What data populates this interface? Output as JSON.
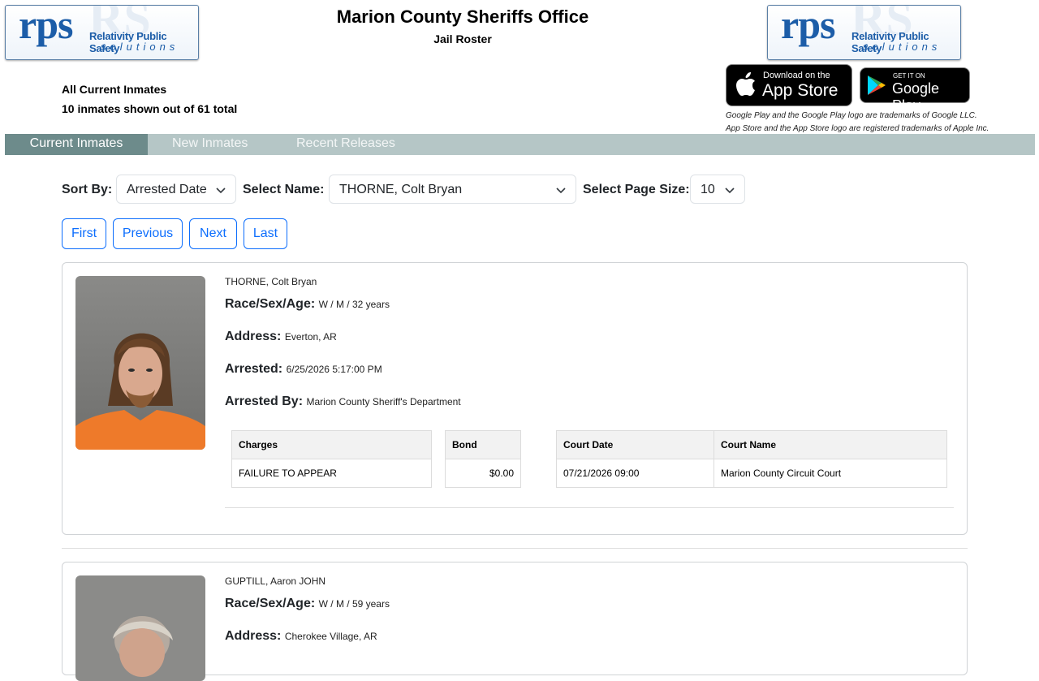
{
  "header": {
    "title": "Marion County Sheriffs Office",
    "subtitle": "Jail Roster"
  },
  "logo": {
    "letters": "rps",
    "line1": "Relativity Public Safety",
    "line2": "solutions"
  },
  "summary": {
    "line1": "All Current Inmates",
    "line2": "10 inmates shown out of 61 total"
  },
  "stores": {
    "apple_small": "Download on the",
    "apple_big": "App Store",
    "google_small": "GET IT ON",
    "google_big": "Google Play",
    "trademark1": "Google Play and the Google Play logo are trademarks of Google LLC.",
    "trademark2": "App Store and the App Store logo are registered trademarks of Apple Inc."
  },
  "tabs": [
    "Current Inmates",
    "New Inmates",
    "Recent Releases"
  ],
  "controls": {
    "sort_label": "Sort By:",
    "sort_value": "Arrested Date",
    "name_label": "Select Name:",
    "name_value": "THORNE, Colt Bryan",
    "size_label": "Select Page Size:",
    "size_value": "10"
  },
  "pager": {
    "first": "First",
    "previous": "Previous",
    "next": "Next",
    "last": "Last"
  },
  "field_labels": {
    "race": "Race/Sex/Age:",
    "address": "Address:",
    "arrested": "Arrested:",
    "arrested_by": "Arrested By:"
  },
  "table_headers": {
    "charges": "Charges",
    "bond": "Bond",
    "court_date": "Court Date",
    "court_name": "Court Name"
  },
  "inmates": [
    {
      "name": "THORNE, Colt Bryan",
      "race_sex_age": "W / M / 32 years",
      "address": "Everton, AR",
      "arrested": "6/25/2026 5:17:00 PM",
      "arrested_by": "Marion County Sheriff's Department",
      "charges": [
        {
          "charge": "FAILURE TO APPEAR",
          "bond": "$0.00"
        }
      ],
      "court": [
        {
          "date": "07/21/2026 09:00",
          "name": "Marion County Circuit Court"
        }
      ]
    },
    {
      "name": "GUPTILL, Aaron JOHN",
      "race_sex_age": "W / M / 59 years",
      "address": "Cherokee Village, AR"
    }
  ],
  "colors": {
    "tab_bar": "#b5c6c6",
    "tab_active": "#6d8b8b",
    "button_blue": "#0d6efd",
    "logo_blue": "#1c5da8",
    "jumpsuit_orange": "#ee7a2a"
  }
}
